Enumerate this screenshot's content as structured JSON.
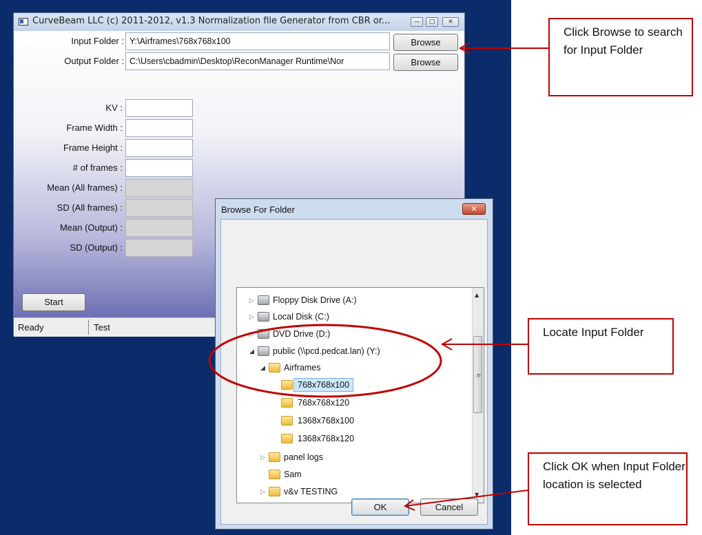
{
  "main_window": {
    "title": "CurveBeam LLC (c) 2011-2012, v1.3 Normalization file Generator from CBR or...",
    "caption_buttons": [
      "minimize",
      "maximize",
      "close"
    ],
    "input_folder": {
      "label": "Input Folder :",
      "value": "Y:\\Airframes\\768x768x100",
      "browse_label": "Browse"
    },
    "output_folder": {
      "label": "Output Folder :",
      "value": "C:\\Users\\cbadmin\\Desktop\\ReconManager Runtime\\Nor",
      "browse_label": "Browse"
    },
    "fields": [
      {
        "label": "KV :",
        "value": "",
        "enabled": true
      },
      {
        "label": "Frame Width :",
        "value": "",
        "enabled": true
      },
      {
        "label": "Frame Height :",
        "value": "",
        "enabled": true
      },
      {
        "label": "# of frames :",
        "value": "",
        "enabled": true
      },
      {
        "label": "Mean (All frames) :",
        "value": "",
        "enabled": false
      },
      {
        "label": "SD (All frames) :",
        "value": "",
        "enabled": false
      },
      {
        "label": "Mean (Output) :",
        "value": "",
        "enabled": false
      },
      {
        "label": "SD (Output) :",
        "value": "",
        "enabled": false
      }
    ],
    "start_label": "Start",
    "status": {
      "left": "Ready",
      "right": "Test"
    }
  },
  "dialog": {
    "title": "Browse For Folder",
    "close_icon": "close-icon",
    "tree": [
      {
        "label": "Floppy Disk Drive (A:)",
        "icon": "floppy-drive-icon",
        "level": 0,
        "expander": "collapsed"
      },
      {
        "label": "Local Disk (C:)",
        "icon": "local-disk-icon",
        "level": 0,
        "expander": "collapsed"
      },
      {
        "label": "DVD Drive (D:)",
        "icon": "dvd-drive-icon",
        "level": 0,
        "expander": "collapsed"
      },
      {
        "label": "public (\\\\pcd.pedcat.lan) (Y:)",
        "icon": "network-drive-icon",
        "level": 0,
        "expander": "expanded"
      },
      {
        "label": "Airframes",
        "icon": "folder-icon",
        "level": 1,
        "expander": "expanded"
      },
      {
        "label": "768x768x100",
        "icon": "folder-icon",
        "level": 2,
        "expander": "none",
        "selected": true
      },
      {
        "label": "768x768x120",
        "icon": "folder-icon",
        "level": 2,
        "expander": "none"
      },
      {
        "label": "1368x768x100",
        "icon": "folder-icon",
        "level": 2,
        "expander": "none"
      },
      {
        "label": "1368x768x120",
        "icon": "folder-icon",
        "level": 2,
        "expander": "none"
      },
      {
        "label": "panel logs",
        "icon": "folder-icon",
        "level": 1,
        "expander": "collapsed"
      },
      {
        "label": "Sam",
        "icon": "folder-icon",
        "level": 1,
        "expander": "none"
      },
      {
        "label": "v&v TESTING",
        "icon": "folder-icon",
        "level": 1,
        "expander": "collapsed"
      }
    ],
    "ok_label": "OK",
    "cancel_label": "Cancel"
  },
  "annotations": [
    {
      "text": "Click Browse to search for Input Folder"
    },
    {
      "text": "Locate Input Folder"
    },
    {
      "text": "Click OK when Input Folder location is selected"
    }
  ],
  "colors": {
    "desktop": "#0b2c6a",
    "annotation": "#c00000",
    "selection": "#cde8fb"
  }
}
